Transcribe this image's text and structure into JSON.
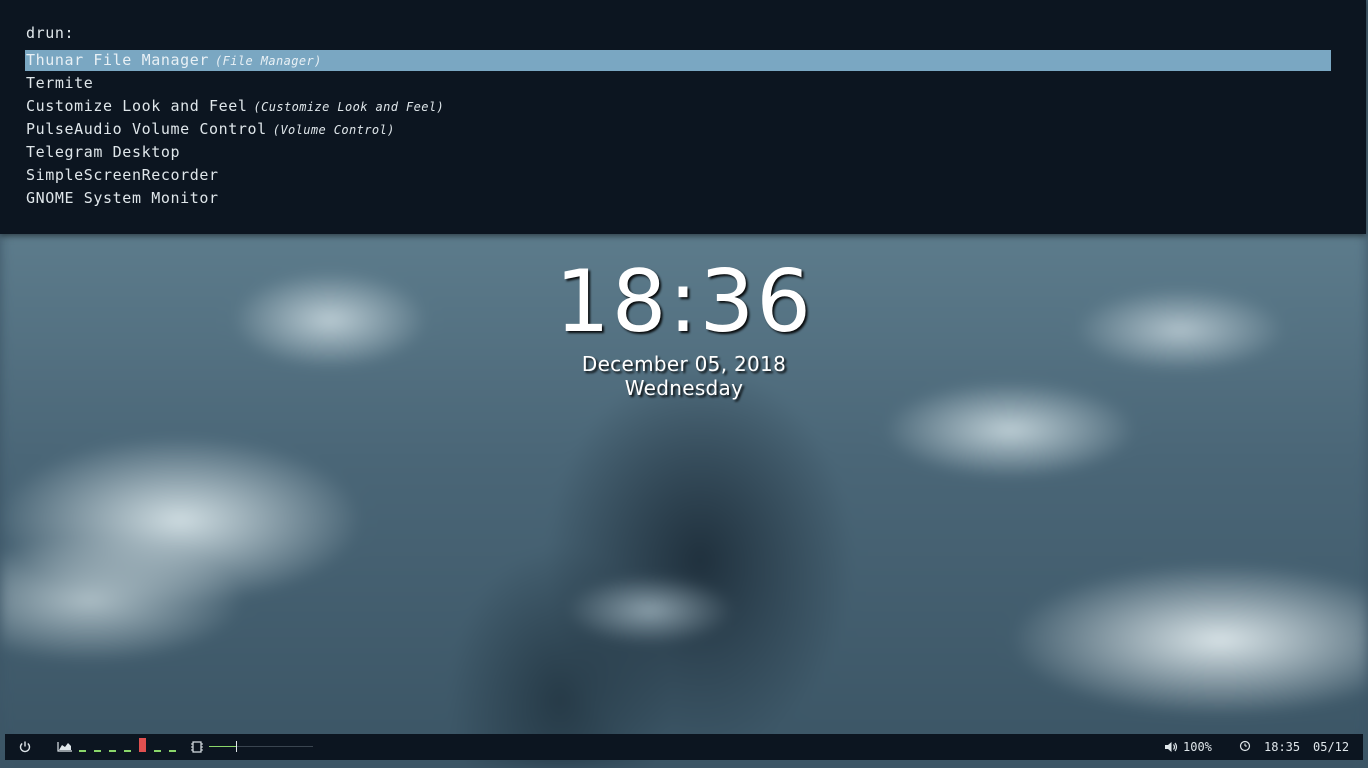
{
  "launcher": {
    "prompt": "drun:",
    "entries": [
      {
        "name": "Thunar File Manager",
        "generic": "(File Manager)",
        "selected": true
      },
      {
        "name": "Termite",
        "generic": ""
      },
      {
        "name": "Customize Look and Feel",
        "generic": "(Customize Look and Feel)"
      },
      {
        "name": "PulseAudio Volume Control",
        "generic": "(Volume Control)"
      },
      {
        "name": "Telegram Desktop",
        "generic": ""
      },
      {
        "name": "SimpleScreenRecorder",
        "generic": ""
      },
      {
        "name": "GNOME System Monitor",
        "generic": ""
      }
    ],
    "selected_color": "#7aa7c2"
  },
  "clock": {
    "time": "18:36",
    "date": "December 05, 2018",
    "day": "Wednesday"
  },
  "bar": {
    "power_icon": "power-icon",
    "cpu_icon": "area-chart-icon",
    "cpu_levels": [
      0.15,
      0.15,
      0.15,
      0.15,
      1.0,
      0.15,
      0.15
    ],
    "cpu_colors": [
      "#8ad66a",
      "#8ad66a",
      "#8ad66a",
      "#8ad66a",
      "#e05050",
      "#8ad66a",
      "#8ad66a"
    ],
    "memory_icon": "chip-icon",
    "memory_level": 0.26,
    "volume_icon": "volume-icon",
    "volume": "100%",
    "clock_icon": "clock-icon",
    "time": "18:35",
    "date": "05/12"
  }
}
